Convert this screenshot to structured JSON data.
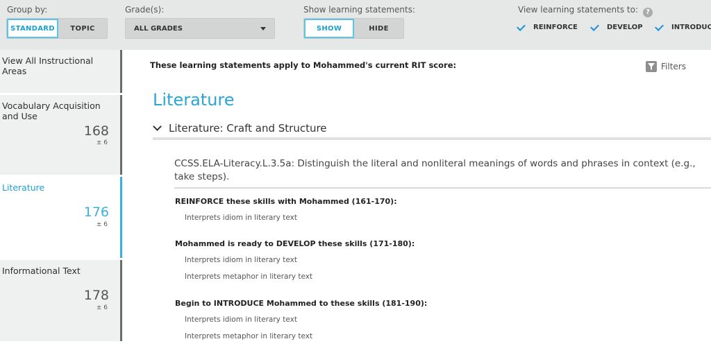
{
  "topbar": {
    "group_by": {
      "label": "Group by:",
      "options": [
        "STANDARD",
        "TOPIC"
      ],
      "selected": "STANDARD"
    },
    "grades": {
      "label": "Grade(s):",
      "value": "ALL GRADES"
    },
    "show_statements": {
      "label": "Show learning statements:",
      "options": [
        "SHOW",
        "HIDE"
      ],
      "selected": "SHOW"
    },
    "view_to": {
      "label": "View learning statements to:",
      "help_icon": "?",
      "checks": [
        {
          "label": "REINFORCE",
          "checked": true
        },
        {
          "label": "DEVELOP",
          "checked": true
        },
        {
          "label": "INTRODUCE",
          "checked": true
        }
      ]
    }
  },
  "sidebar": {
    "items": [
      {
        "title": "View All Instructional Areas"
      },
      {
        "title": "Vocabulary Acquisition and Use",
        "score": "168",
        "error": "± 6"
      },
      {
        "title": "Literature",
        "score": "176",
        "error": "± 6",
        "active": true
      },
      {
        "title": "Informational Text",
        "score": "178",
        "error": "± 6"
      }
    ]
  },
  "main": {
    "applies_text": "These learning statements apply to Mohammed's current RIT score:",
    "filters_label": "Filters",
    "heading": "Literature",
    "subheading": "Literature: Craft and Structure",
    "standard": "CCSS.ELA-Literacy.L.3.5a: Distinguish the literal and nonliteral meanings of words and phrases in context (e.g., take steps).",
    "sections": [
      {
        "title": "REINFORCE these skills with Mohammed (161-170):",
        "skills": [
          "Interprets idiom in literary text"
        ]
      },
      {
        "title": "Mohammed is ready to DEVELOP these skills (171-180):",
        "skills": [
          "Interprets idiom in literary text",
          "Interprets metaphor in literary text"
        ]
      },
      {
        "title": "Begin to INTRODUCE Mohammed to these skills (181-190):",
        "skills": [
          "Interprets idiom in literary text",
          "Interprets metaphor in literary text"
        ]
      }
    ]
  },
  "colors": {
    "accent": "#2aa6d6",
    "check": "#1a8fd6",
    "bar_bg": "#e6e8e7"
  }
}
